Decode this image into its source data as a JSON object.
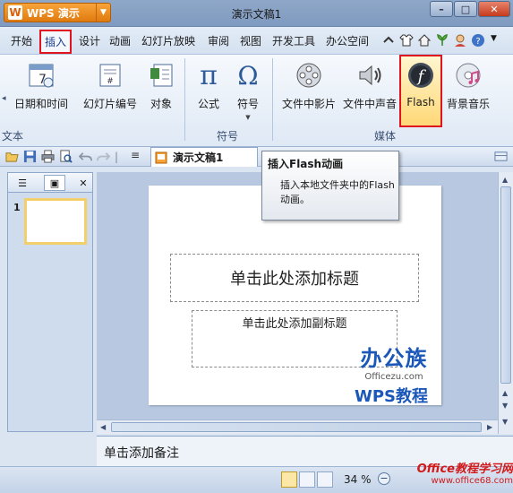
{
  "app": {
    "name": "WPS 演示",
    "logo": "W",
    "window_title": "演示文稿1"
  },
  "tabs": [
    "开始",
    "插入",
    "设计",
    "动画",
    "幻灯片放映",
    "审阅",
    "视图",
    "开发工具",
    "办公空间"
  ],
  "active_tab": "插入",
  "ribbon": {
    "groups": [
      {
        "name": "文本",
        "buttons": [
          "日期和时间",
          "幻灯片编号",
          "对象"
        ]
      },
      {
        "name": "符号",
        "buttons": [
          "公式",
          "符号"
        ]
      },
      {
        "name": "媒体",
        "buttons": [
          "文件中影片",
          "文件中声音",
          "Flash",
          "背景音乐"
        ]
      }
    ],
    "highlighted_button": "Flash"
  },
  "doc_tab": "演示文稿1",
  "slide_panel": {
    "slide_number": "1"
  },
  "slide": {
    "title_placeholder": "单击此处添加标题",
    "subtitle_placeholder": "单击此处添加副标题"
  },
  "notes_placeholder": "单击添加备注",
  "status": {
    "zoom": "34 %"
  },
  "tooltip": {
    "title": "插入Flash动画",
    "body": "插入本地文件夹中的Flash动画。"
  },
  "watermarks": {
    "office_cn": "办公族",
    "office_en": "Officezu.com",
    "wps_tutorial": "WPS教程",
    "site_cn": "Office教程学习网",
    "site_en": "www.office68.com"
  },
  "colors": {
    "highlight": "#e0141e",
    "accent": "#1a57b8"
  }
}
